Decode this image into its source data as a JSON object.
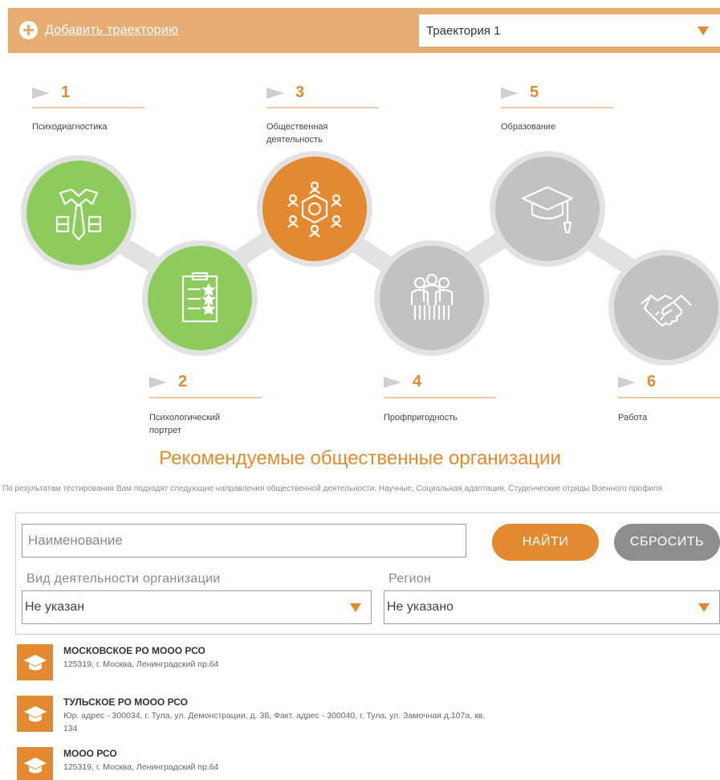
{
  "header": {
    "add_trajectory_label": "Добавить траекторию",
    "trajectory_select_value": "Траектория 1"
  },
  "steps": [
    {
      "number": "1",
      "label": "Психодиагностика",
      "status": "done",
      "icon": "shirt-tie-icon"
    },
    {
      "number": "2",
      "label": "Психологический портрет",
      "status": "done",
      "icon": "clipboard-stars-icon"
    },
    {
      "number": "3",
      "label": "Общественная деятельность",
      "status": "active",
      "icon": "people-network-icon"
    },
    {
      "number": "4",
      "label": "Профпригодность",
      "status": "pending",
      "icon": "group-people-icon"
    },
    {
      "number": "5",
      "label": "Образование",
      "status": "pending",
      "icon": "graduation-cap-icon"
    },
    {
      "number": "6",
      "label": "Работа",
      "status": "pending",
      "icon": "handshake-icon"
    }
  ],
  "colors": {
    "accent": "#e3892f",
    "header_bg": "#e6ac72",
    "done": "#8dcc5c",
    "pending": "#c2c2c2",
    "reset_button": "#8d8d8d"
  },
  "section": {
    "title": "Рекомендуемые общественные организации",
    "note": "По результатам тестирования Вам подходят следующие направления общественной деятельности: Научные, Социальная адаптация, Студенческие отряды Военного профиля"
  },
  "filters": {
    "name_placeholder": "Наименование",
    "find_label": "НАЙТИ",
    "reset_label": "СБРОСИТЬ",
    "activity_label": "Вид деятельности организации",
    "activity_value": "Не указан",
    "region_label": "Регион",
    "region_value": "Не указано"
  },
  "organizations": [
    {
      "name": "МОСКОВСКОЕ РО МООО РСО",
      "address": "125319, г. Москва, Ленинградский пр.64"
    },
    {
      "name": "ТУЛЬСКОЕ РО МООО РСО",
      "address": "Юр. адрес - 300034, г. Тула, ул. Демонстрации, д. 38, Факт. адрес - 300040, г. Тула, ул. Замочная д.107а, кв. 134"
    },
    {
      "name": "МООО РСО",
      "address": "125319, г. Москва, Ленинградский пр.64"
    }
  ]
}
